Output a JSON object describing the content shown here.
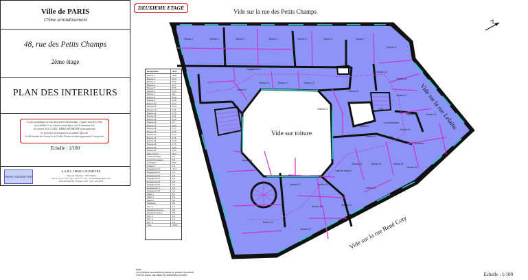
{
  "cartouche": {
    "city": "Ville de PARIS",
    "arrondissement": "17ème arrondissement",
    "address": "48, rue des Petits Champs",
    "floor": "2ème étage",
    "plan_title": "PLAN DES INTERIEURS",
    "notice": [
      "Ce plan graphique est issu d'un fichier informatique. Compte tenu de la libre",
      "accessibilité à ces données numériques, seul le document tiré",
      "du cabinet de la S.A.R.L. IMMO-GEOMETRE ayant approuvé",
      "les présentes informations a la validité officielle.",
      "La déclaration des locaux et de l'ordre d'achat du bâtis appartient à l'acquéreur."
    ],
    "scale": "Echelle : 1/100",
    "company": {
      "logo_text": "IMMO-GEOMETRE",
      "name": "S.A.R.L. IMMO-GEOMETRE",
      "address": "7 Rue des Falkenpié · 75017 PARIS",
      "contact": "Tél.: 01 47 57 77 00 · Fax.: 01 47 57 77 00 · www.immogeometre.com",
      "registration": "Siret: 000 000 000 · Ecomas: 1234 · Siret: 1234 5678"
    }
  },
  "level_badge": "DEUXIEME ETAGE",
  "streets": {
    "top": "Vide sur la rue des Petits Champs",
    "right": "Vide sur la rue Lelains",
    "bottom": "Vide sur la rue René Coty"
  },
  "courtyard_label": "Vide sur toiture",
  "room_labels": [
    "Bureau 1",
    "Bureau 2",
    "Bureau 3",
    "Bureau 4",
    "Bureau 5",
    "Bureau 6",
    "Bureau 7",
    "Bureau 8",
    "Dégagement 1",
    "Bureau 9",
    "Bureau 10",
    "Bureau 11",
    "Bureau 12",
    "Bureau 13",
    "Bureau 14",
    "Bureau 15",
    "Bureau 16",
    "Bureau 17",
    "Bureau 18",
    "Bureau 19",
    "Bureau 20",
    "Bureau 21",
    "Bureau 22",
    "Bureau 23",
    "Bureau 24",
    "Bureau 25",
    "Salle de réunion",
    "Circulation",
    "Local technique",
    "Sanitaires",
    "Palier",
    "Bureau 26",
    "Bureau 27",
    "Bureau 28",
    "Bureau 29",
    "Bureau 30",
    "Bureau 31",
    "Bureau 32",
    "Bureau 33",
    "Bureau 34"
  ],
  "legend": {
    "headers": [
      "Désignation",
      "Surf."
    ],
    "rows": [
      [
        "Bureau 1",
        "38,8"
      ],
      [
        "Bureau 2",
        "16,0"
      ],
      [
        "Bureau 3",
        "18,9"
      ],
      [
        "Bureau 4",
        "21,7"
      ],
      [
        "Bureau 5",
        "15,5"
      ],
      [
        "Bureau 6",
        "12,3"
      ],
      [
        "Bureau 7",
        "8,9"
      ],
      [
        "Bureau 8",
        "10,8"
      ],
      [
        "Bureau 9",
        "14,8"
      ],
      [
        "Bureau 10",
        "16,2"
      ],
      [
        "Bureau 11",
        "13,4"
      ],
      [
        "Bureau 12",
        "11,6"
      ],
      [
        "Bureau 13",
        "17,5"
      ],
      [
        "Bureau 14",
        "15,1"
      ],
      [
        "Bureau 15",
        "13,9"
      ],
      [
        "Bureau 16",
        "9,7"
      ],
      [
        "Bureau 17",
        "26,0"
      ],
      [
        "Bureau 18",
        "17,7"
      ],
      [
        "Bureau 19",
        "13,5"
      ],
      [
        "Bureau 20",
        "12,4"
      ],
      [
        "Bureau 21",
        "11,5"
      ],
      [
        "Bureau 22",
        "12,8"
      ],
      [
        "Bureau 23",
        "17,6"
      ],
      [
        "Bureau 24",
        "15,8"
      ],
      [
        "Bureau 25",
        "19,0"
      ],
      [
        "Salle réunion",
        "30,2"
      ],
      [
        "Local technique",
        "3,4"
      ],
      [
        "Local informatique",
        "5,3"
      ],
      [
        "Circulation",
        "62,5"
      ],
      [
        "Cuisine 1",
        "7,4"
      ],
      [
        "Dégagement 1",
        "42,4"
      ],
      [
        "Dégagement 2",
        "3,1"
      ],
      [
        "Dégagement 3",
        "1,8"
      ],
      [
        "Dégagement 4",
        "5,3"
      ],
      [
        "Dégagement 5",
        "2,6"
      ],
      [
        "Dégagement 6",
        "4,2"
      ],
      [
        "Dégagement 7",
        "2,9"
      ],
      [
        "Dégagement 8",
        "1,8"
      ],
      [
        "Palier 1",
        "8,7"
      ],
      [
        "Palier 2",
        "5,3"
      ],
      [
        "Palier 3",
        "4,6"
      ],
      [
        "Sanitaires",
        "9,6"
      ],
      [
        "W.C. 1",
        "1,3"
      ],
      [
        "Sanitaires homme",
        "3,8"
      ],
      [
        "Sanitaires femme",
        "3,9"
      ],
      [
        "W.C. 2",
        "1,2"
      ],
      [
        "W.C. 3",
        "1,4"
      ],
      [
        "W.C. 4",
        "1,6"
      ],
      [
        "Total",
        "754,8"
      ]
    ]
  },
  "note": [
    "Note :",
    "Les Surfaces considérées portées au présent document,",
    "n'ont en aucun cas valeur de délimitation foncière."
  ],
  "plan_scale": "Echelle : 1/100",
  "colors": {
    "room": "#8c94f7",
    "wall": "#111111",
    "partition": "#cc33cc",
    "glass": "#2fc6c6",
    "accent": "#cc0000"
  }
}
